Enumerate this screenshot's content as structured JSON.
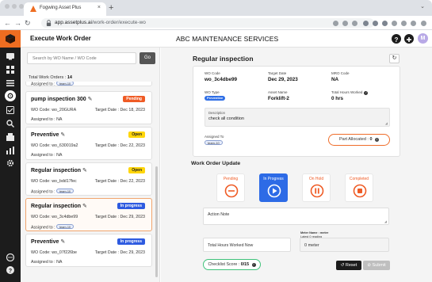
{
  "browser": {
    "tab_title": "Fogwing Asset Plus",
    "url_host": "app.assetplus.ai",
    "url_path": "/work-order/execute-wo",
    "new_tab_symbol": "+",
    "tab_close_symbol": "×"
  },
  "header": {
    "page_title": "Execute Work Order",
    "company": "ABC MAINTENANCE SERVICES",
    "avatar_initial": "M"
  },
  "list": {
    "search_placeholder": "Search by WO Name / WO Code",
    "go_label": "Go",
    "total_label": "Total Work Orders : ",
    "total_count": "14",
    "partial_assigned": "Assigned to :",
    "partial_assignee": "team-10",
    "items": [
      {
        "title": "pump inspection 300",
        "status": "Pending",
        "code": "WO Code: wo_20GURA",
        "date": "Target Date : Dec 18, 2023",
        "assigned": "Assigned to : NA",
        "assignee": ""
      },
      {
        "title": "Preventive",
        "status": "Open",
        "code": "WO Code: wo_630019a2",
        "date": "Target Date : Dec 22, 2023",
        "assigned": "Assigned to : NA",
        "assignee": ""
      },
      {
        "title": "Regular inspection",
        "status": "Open",
        "code": "WO Code: wo_bdd17fec",
        "date": "Target Date : Dec 22, 2023",
        "assigned": "Assigned to :",
        "assignee": "team-10"
      },
      {
        "title": "Regular inspection",
        "status": "In progress",
        "code": "WO Code: wo_3c4dbe99",
        "date": "Target Date : Dec 29, 2023",
        "assigned": "Assigned to :",
        "assignee": "team-10"
      },
      {
        "title": "Preventive",
        "status": "In progress",
        "code": "WO Code: wo_07f226be",
        "date": "Target Date : Dec 29, 2023",
        "assigned": "Assigned to : NA",
        "assignee": ""
      }
    ]
  },
  "detail": {
    "title": "Regular inspection",
    "refresh_symbol": "↻",
    "fields": {
      "wo_code_label": "WO Code",
      "wo_code": "wo_3c4dbe99",
      "target_date_label": "Target Date",
      "target_date": "Dec 29, 2023",
      "mro_code_label": "MRO Code",
      "mro_code": "NA",
      "wo_type_label": "WO Type",
      "wo_type": "Preventive",
      "asset_name_label": "Asset Name",
      "asset_name": "Forklift-2",
      "total_hours_label": "Total Hours Worked",
      "total_hours": "0 hrs",
      "description_label": "Description",
      "description": "check all condition",
      "assigned_label": "Assigned To",
      "assigned_to": "team-10",
      "part_allocated_label": "Part Allocated : ",
      "part_allocated_count": "0"
    },
    "update_title": "Work Order Update",
    "statuses": [
      {
        "label": "Pending",
        "icon": "minus-circle-icon"
      },
      {
        "label": "In Progress",
        "icon": "play-circle-icon"
      },
      {
        "label": "On Hold",
        "icon": "pause-circle-icon"
      },
      {
        "label": "Completed",
        "icon": "stop-circle-icon"
      }
    ],
    "active_status": "In Progress",
    "action_note_label": "Action Note",
    "hours_worked_label": "Total Hours Worked Now",
    "meter_name_label": "Meter Name : meter",
    "meter_caption": "Latest 0 reading",
    "meter_value": "0 meter",
    "checklist_label": "Checklist Score : ",
    "checklist_score": "0/15",
    "reset_label": "Reset",
    "submit_label": "Submit"
  },
  "colors": {
    "brand_orange": "#ee6d21",
    "sidebar_dark": "#1c1c1c",
    "active_blue": "#2d6be6",
    "pending_orange": "#ef5b25",
    "open_yellow": "#ffd60a",
    "checklist_green": "#3fc27a"
  }
}
